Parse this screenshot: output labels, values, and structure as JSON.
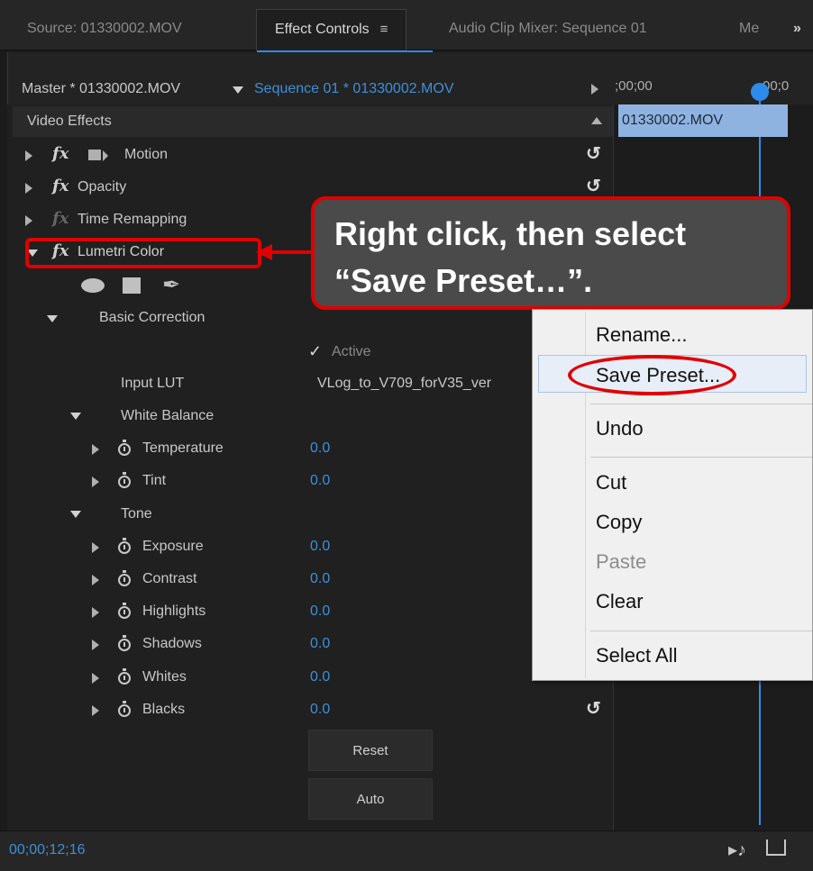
{
  "tabs": [
    {
      "label": "Source: 01330002.MOV"
    },
    {
      "label": "Effect Controls"
    },
    {
      "label": "Audio Clip Mixer: Sequence 01"
    },
    {
      "label": "Me"
    }
  ],
  "tab_overflow": "»",
  "tab_menu_icon": "≡",
  "header": {
    "master": "Master * 01330002.MOV",
    "sequence": "Sequence 01 * 01330002.MOV",
    "timecode_start": ";00;00",
    "timecode_end": "00;0"
  },
  "section_title": "Video Effects",
  "timeline_clip": "01330002.MOV",
  "effects": {
    "motion": "Motion",
    "opacity": "Opacity",
    "time_remapping": "Time Remapping",
    "lumetri": "Lumetri Color",
    "fx_glyph": "fx"
  },
  "basic_correction": "Basic Correction",
  "active_label": "Active",
  "input_lut_label": "Input LUT",
  "input_lut_value": "VLog_to_V709_forV35_ver",
  "white_balance": "White Balance",
  "wb_params": [
    {
      "name": "Temperature",
      "value": "0.0"
    },
    {
      "name": "Tint",
      "value": "0.0"
    }
  ],
  "tone": "Tone",
  "tone_params": [
    {
      "name": "Exposure",
      "value": "0.0"
    },
    {
      "name": "Contrast",
      "value": "0.0"
    },
    {
      "name": "Highlights",
      "value": "0.0"
    },
    {
      "name": "Shadows",
      "value": "0.0"
    },
    {
      "name": "Whites",
      "value": "0.0"
    },
    {
      "name": "Blacks",
      "value": "0.0"
    }
  ],
  "buttons": {
    "reset": "Reset",
    "auto": "Auto"
  },
  "footer_timecode": "00;00;12;16",
  "callout": {
    "line1": "Right click, then select",
    "line2": "“Save Preset…”."
  },
  "context_menu": {
    "rename": "Rename...",
    "save_preset": "Save Preset...",
    "undo": "Undo",
    "cut": "Cut",
    "copy": "Copy",
    "paste": "Paste",
    "clear": "Clear",
    "select_all": "Select All"
  },
  "icons": [
    "menu-icon",
    "overflow-icon",
    "dropdown-triangle-icon",
    "expand-triangle-icon",
    "collapse-triangle-icon",
    "fx-icon",
    "reset-icon",
    "stopwatch-icon",
    "ellipse-mask-icon",
    "rect-mask-icon",
    "pen-mask-icon",
    "checkmark-icon",
    "play-audio-icon",
    "export-icon"
  ],
  "colors": {
    "accent": "#2d8ceb",
    "value_blue": "#3d8fd9",
    "annotation_red": "#e00000"
  }
}
